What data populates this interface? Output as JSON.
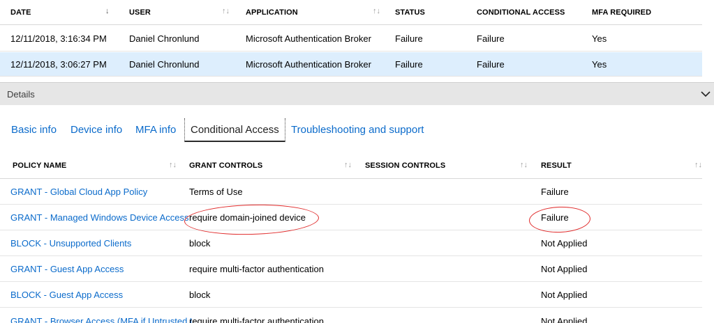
{
  "signins": {
    "columns": [
      "DATE",
      "USER",
      "APPLICATION",
      "STATUS",
      "CONDITIONAL ACCESS",
      "MFA REQUIRED"
    ],
    "rows": [
      {
        "date": "12/11/2018, 3:16:34 PM",
        "user": "Daniel Chronlund",
        "application": "Microsoft Authentication Broker",
        "status": "Failure",
        "conditional_access": "Failure",
        "mfa_required": "Yes"
      },
      {
        "date": "12/11/2018, 3:06:27 PM",
        "user": "Daniel Chronlund",
        "application": "Microsoft Authentication Broker",
        "status": "Failure",
        "conditional_access": "Failure",
        "mfa_required": "Yes"
      }
    ],
    "sort_icon": "↑↓",
    "sort_icon_active": "↓"
  },
  "details": {
    "label": "Details",
    "icon": "chevron-down-icon"
  },
  "tabs": [
    {
      "label": "Basic info"
    },
    {
      "label": "Device info"
    },
    {
      "label": "MFA info"
    },
    {
      "label": "Conditional Access",
      "active": true
    },
    {
      "label": "Troubleshooting and support"
    }
  ],
  "policies": {
    "columns": [
      "POLICY NAME",
      "GRANT CONTROLS",
      "SESSION CONTROLS",
      "RESULT"
    ],
    "rows": [
      {
        "name": "GRANT - Global Cloud App Policy",
        "grant": "Terms of Use",
        "session": "",
        "result": "Failure"
      },
      {
        "name": "GRANT - Managed Windows Device Access",
        "grant": "require domain-joined device",
        "session": "",
        "result": "Failure"
      },
      {
        "name": "BLOCK - Unsupported Clients",
        "grant": "block",
        "session": "",
        "result": "Not Applied"
      },
      {
        "name": "GRANT - Guest App Access",
        "grant": "require multi-factor authentication",
        "session": "",
        "result": "Not Applied"
      },
      {
        "name": "BLOCK - Guest App Access",
        "grant": "block",
        "session": "",
        "result": "Not Applied"
      },
      {
        "name": "GRANT - Browser Access (MFA if Untrusted L",
        "grant": "require multi-factor authentication",
        "session": "",
        "result": "Not Applied"
      }
    ]
  },
  "colors": {
    "link": "#0b6bcb",
    "selected_row": "#ddeefd",
    "annotation": "#e02a2a"
  }
}
